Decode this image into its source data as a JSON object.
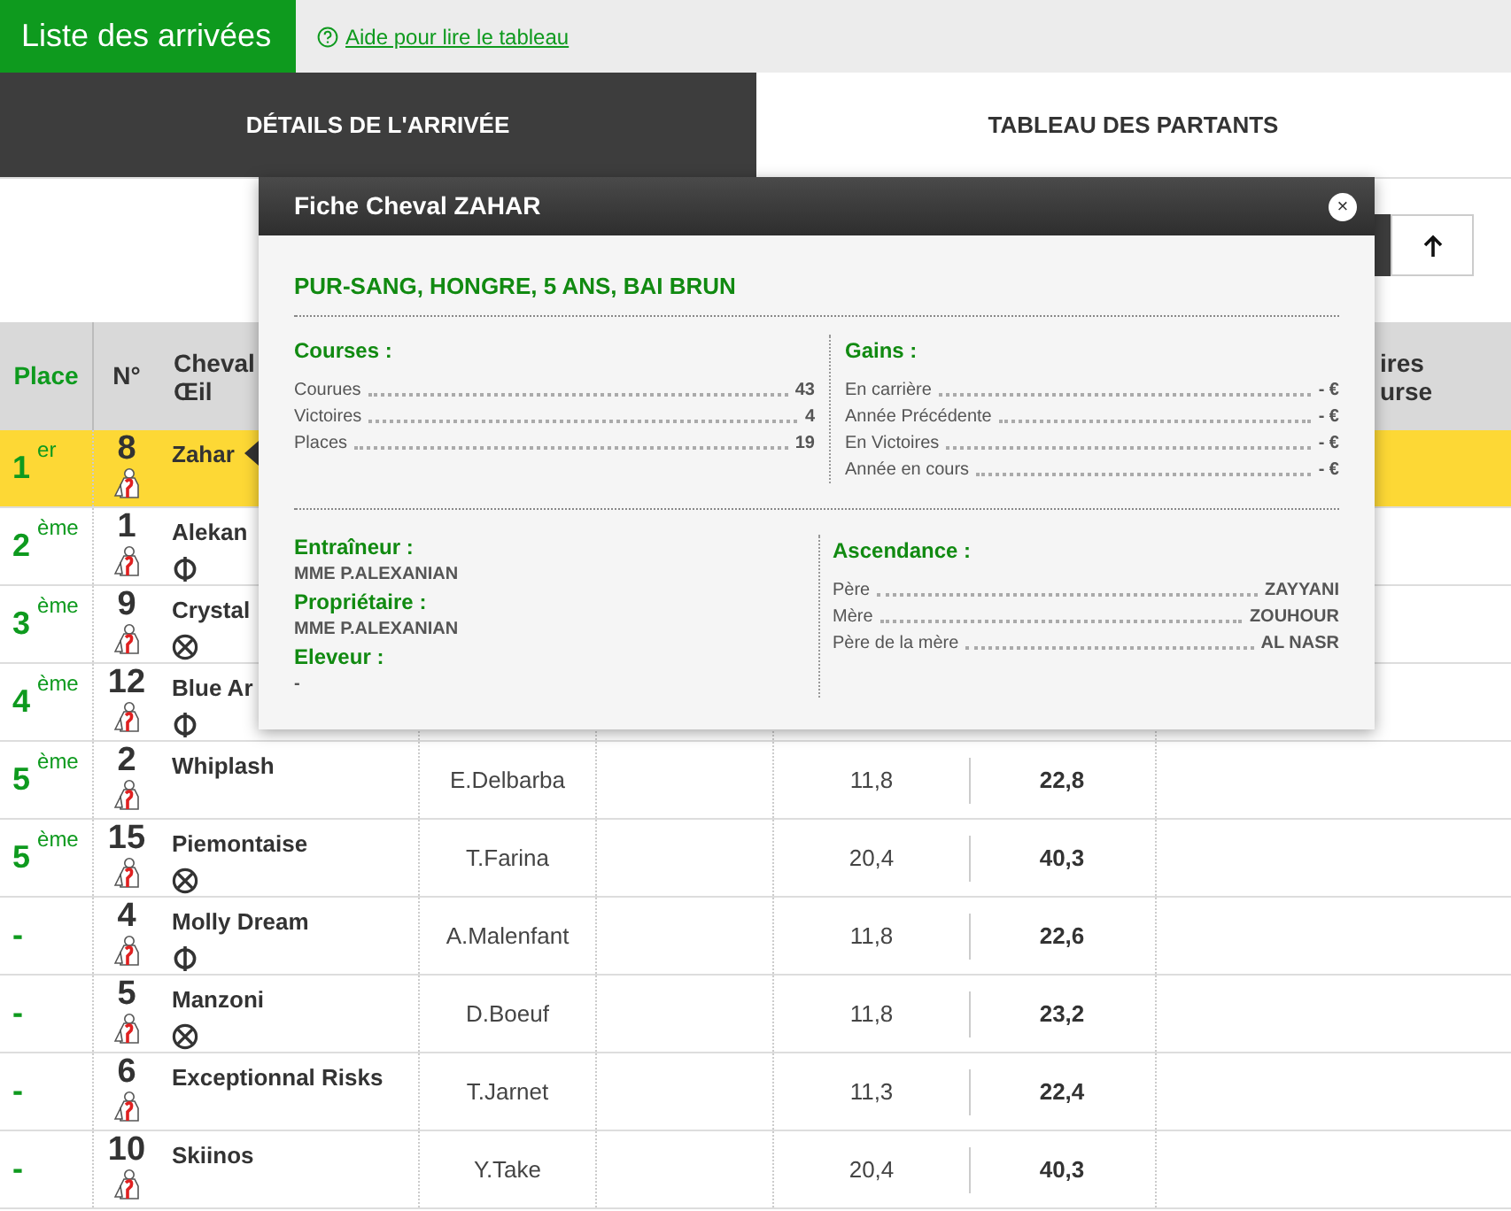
{
  "header": {
    "title": "Liste des arrivées",
    "help_link": "Aide pour lire le tableau"
  },
  "tabs": [
    {
      "label": "DÉTAILS DE L'ARRIVÉE",
      "selected": true
    },
    {
      "label": "TABLEAU DES PARTANTS",
      "selected": false
    }
  ],
  "table": {
    "columns": [
      "Place",
      "N°",
      "Cheval",
      "Œil",
      "ires",
      "urse"
    ],
    "rows": [
      {
        "place": "1",
        "suffix": "er",
        "number": "8",
        "name": "Zahar",
        "kind": "none",
        "selected": true
      },
      {
        "place": "2",
        "suffix": "ème",
        "number": "1",
        "name": "Alekan",
        "kind": "phi",
        "selected": false
      },
      {
        "place": "3",
        "suffix": "ème",
        "number": "9",
        "name": "Crystal",
        "kind": "cross",
        "selected": false
      },
      {
        "place": "4",
        "suffix": "ème",
        "number": "12",
        "name": "Blue Ar",
        "kind": "phi",
        "selected": false
      },
      {
        "place": "5",
        "suffix": "ème",
        "number": "2",
        "name": "Whiplash",
        "kind": "none",
        "jockey": "E.Delbarba",
        "value_1": "11,8",
        "value_2": "22,8",
        "selected": false
      },
      {
        "place": "5",
        "suffix": "ème",
        "number": "15",
        "name": "Piemontaise",
        "kind": "cross",
        "jockey": "T.Farina",
        "value_1": "20,4",
        "value_2": "40,3",
        "selected": false
      },
      {
        "place": "-",
        "number": "4",
        "name": "Molly Dream",
        "kind": "phi",
        "jockey": "A.Malenfant",
        "value_1": "11,8",
        "value_2": "22,6",
        "selected": false
      },
      {
        "place": "-",
        "number": "5",
        "name": "Manzoni",
        "kind": "cross",
        "jockey": "D.Boeuf",
        "value_1": "11,8",
        "value_2": "23,2",
        "selected": false
      },
      {
        "place": "-",
        "number": "6",
        "name": "Exceptionnal Risks",
        "kind": "none",
        "jockey": "T.Jarnet",
        "value_1": "11,3",
        "value_2": "22,4",
        "selected": false
      },
      {
        "place": "-",
        "number": "10",
        "name": "Skiinos",
        "kind": "none",
        "jockey": "Y.Take",
        "value_1": "20,4",
        "value_2": "40,3",
        "selected": false
      }
    ]
  },
  "popup": {
    "title": "Fiche Cheval ZAHAR",
    "close": "×",
    "subtitle": "PUR-SANG, HONGRE, 5 ANS, BAI BRUN",
    "courses": {
      "heading": "Courses :",
      "items": [
        {
          "label": "Courues",
          "value": "43"
        },
        {
          "label": "Victoires",
          "value": "4"
        },
        {
          "label": "Places",
          "value": "19"
        }
      ]
    },
    "gains": {
      "heading": "Gains :",
      "items": [
        {
          "label": "En carrière",
          "value": "- €"
        },
        {
          "label": "Année Précédente",
          "value": "- €"
        },
        {
          "label": "En Victoires",
          "value": "- €"
        },
        {
          "label": "Année en cours",
          "value": "- €"
        }
      ]
    },
    "people": [
      {
        "heading": "Entraîneur :",
        "value": "MME P.ALEXANIAN"
      },
      {
        "heading": "Propriétaire :",
        "value": "MME P.ALEXANIAN"
      },
      {
        "heading": "Eleveur :",
        "value": "-"
      }
    ],
    "ascendance": {
      "heading": "Ascendance :",
      "items": [
        {
          "label": "Père",
          "value": "ZAYYANI"
        },
        {
          "label": "Mère",
          "value": "ZOUHOUR"
        },
        {
          "label": "Père de la mère",
          "value": "AL NASR"
        }
      ]
    }
  }
}
